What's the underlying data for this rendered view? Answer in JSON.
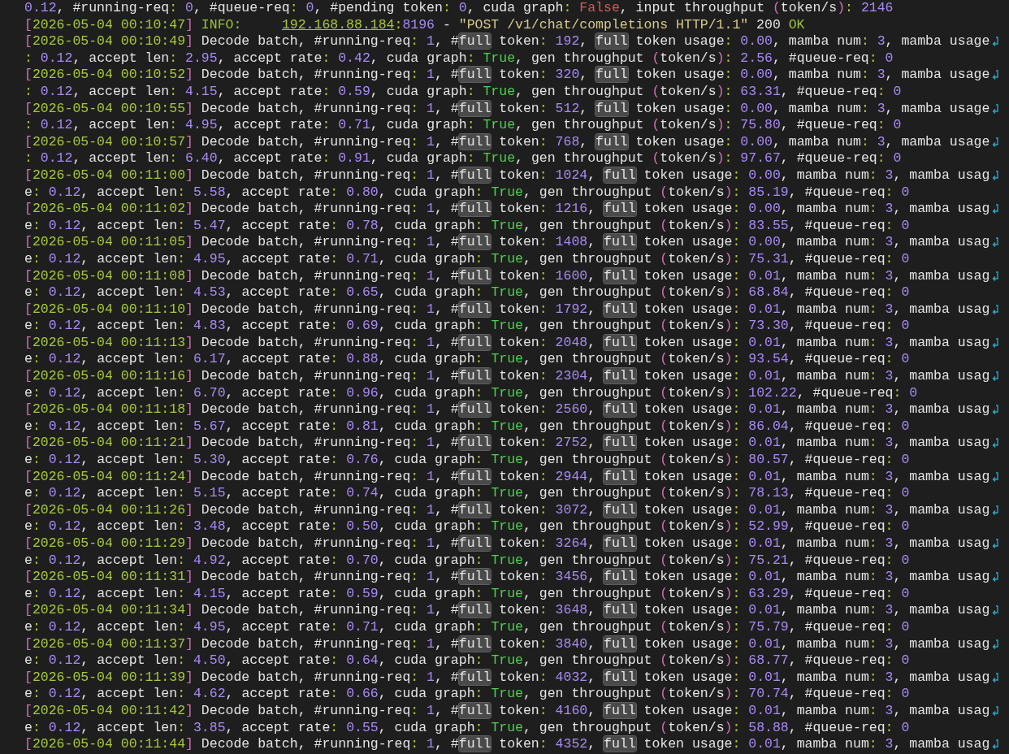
{
  "terminal": {
    "top_line": "0.12, #running-req: 0, #queue-req: 0, #pending token: 0, cuda graph: False, input throughput (token/s): 2146",
    "request_line": [
      {
        "text": "[2026-05-04 00:10:47]",
        "kind": "timestamp"
      },
      {
        "text": " INFO:     ",
        "kind": "level"
      },
      {
        "text": "192.168.88.184",
        "kind": "address"
      },
      {
        "text": ":8196",
        "kind": "port"
      },
      {
        "text": " - ",
        "kind": "plain"
      },
      {
        "text": "\"POST /v1/chat/completions HTTP/1.1\"",
        "kind": "string"
      },
      {
        "text": " 200 ",
        "kind": "plain"
      },
      {
        "text": "OK",
        "kind": "status"
      }
    ],
    "entries": [
      {
        "parts": [
          "[2026-05-04 00:10:49] Decode batch, #running-req: 1, #",
          "full",
          " token: 192, ",
          "full",
          " token usage: 0.00, mamba num: 3, mamba usage: 0.12, accept len: 2.95, accept rate: 0.42, cuda graph: True, gen throughput (token/s): 2.56, #queue-req: 0"
        ]
      },
      {
        "parts": [
          "[2026-05-04 00:10:52] Decode batch, #running-req: 1, #",
          "full",
          " token: 320, ",
          "full",
          " token usage: 0.00, mamba num: 3, mamba usage: 0.12, accept len: 4.15, accept rate: 0.59, cuda graph: True, gen throughput (token/s): 63.31, #queue-req: 0"
        ]
      },
      {
        "parts": [
          "[2026-05-04 00:10:55] Decode batch, #running-req: 1, #",
          "full",
          " token: 512, ",
          "full",
          " token usage: 0.00, mamba num: 3, mamba usage: 0.12, accept len: 4.95, accept rate: 0.71, cuda graph: True, gen throughput (token/s): 75.80, #queue-req: 0"
        ]
      },
      {
        "parts": [
          "[2026-05-04 00:10:57] Decode batch, #running-req: 1, #",
          "full",
          " token: 768, ",
          "full",
          " token usage: 0.00, mamba num: 3, mamba usage: 0.12, accept len: 6.40, accept rate: 0.91, cuda graph: True, gen throughput (token/s): 97.67, #queue-req: 0"
        ]
      },
      {
        "parts": [
          "[2026-05-04 00:11:00] Decode batch, #running-req: 1, #",
          "full",
          " token: 1024, ",
          "full",
          " token usage: 0.00, mamba num: 3, mamba usage: 0.12, accept len: 5.58, accept rate: 0.80, cuda graph: True, gen throughput (token/s): 85.19, #queue-req: 0"
        ]
      },
      {
        "parts": [
          "[2026-05-04 00:11:02] Decode batch, #running-req: 1, #",
          "full",
          " token: 1216, ",
          "full",
          " token usage: 0.00, mamba num: 3, mamba usage: 0.12, accept len: 5.47, accept rate: 0.78, cuda graph: True, gen throughput (token/s): 83.55, #queue-req: 0"
        ]
      },
      {
        "parts": [
          "[2026-05-04 00:11:05] Decode batch, #running-req: 1, #",
          "full",
          " token: 1408, ",
          "full",
          " token usage: 0.00, mamba num: 3, mamba usage: 0.12, accept len: 4.95, accept rate: 0.71, cuda graph: True, gen throughput (token/s): 75.31, #queue-req: 0"
        ]
      },
      {
        "parts": [
          "[2026-05-04 00:11:08] Decode batch, #running-req: 1, #",
          "full",
          " token: 1600, ",
          "full",
          " token usage: 0.01, mamba num: 3, mamba usage: 0.12, accept len: 4.53, accept rate: 0.65, cuda graph: True, gen throughput (token/s): 68.84, #queue-req: 0"
        ]
      },
      {
        "parts": [
          "[2026-05-04 00:11:10] Decode batch, #running-req: 1, #",
          "full",
          " token: 1792, ",
          "full",
          " token usage: 0.01, mamba num: 3, mamba usage: 0.12, accept len: 4.83, accept rate: 0.69, cuda graph: True, gen throughput (token/s): 73.30, #queue-req: 0"
        ]
      },
      {
        "parts": [
          "[2026-05-04 00:11:13] Decode batch, #running-req: 1, #",
          "full",
          " token: 2048, ",
          "full",
          " token usage: 0.01, mamba num: 3, mamba usage: 0.12, accept len: 6.17, accept rate: 0.88, cuda graph: True, gen throughput (token/s): 93.54, #queue-req: 0"
        ]
      },
      {
        "parts": [
          "[2026-05-04 00:11:16] Decode batch, #running-req: 1, #",
          "full",
          " token: 2304, ",
          "full",
          " token usage: 0.01, mamba num: 3, mamba usage: 0.12, accept len: 6.70, accept rate: 0.96, cuda graph: True, gen throughput (token/s): 102.22, #queue-req: 0"
        ]
      },
      {
        "parts": [
          "[2026-05-04 00:11:18] Decode batch, #running-req: 1, #",
          "full",
          " token: 2560, ",
          "full",
          " token usage: 0.01, mamba num: 3, mamba usage: 0.12, accept len: 5.67, accept rate: 0.81, cuda graph: True, gen throughput (token/s): 86.04, #queue-req: 0"
        ]
      },
      {
        "parts": [
          "[2026-05-04 00:11:21] Decode batch, #running-req: 1, #",
          "full",
          " token: 2752, ",
          "full",
          " token usage: 0.01, mamba num: 3, mamba usage: 0.12, accept len: 5.30, accept rate: 0.76, cuda graph: True, gen throughput (token/s): 80.57, #queue-req: 0"
        ]
      },
      {
        "parts": [
          "[2026-05-04 00:11:24] Decode batch, #running-req: 1, #",
          "full",
          " token: 2944, ",
          "full",
          " token usage: 0.01, mamba num: 3, mamba usage: 0.12, accept len: 5.15, accept rate: 0.74, cuda graph: True, gen throughput (token/s): 78.13, #queue-req: 0"
        ]
      },
      {
        "parts": [
          "[2026-05-04 00:11:26] Decode batch, #running-req: 1, #",
          "full",
          " token: 3072, ",
          "full",
          " token usage: 0.01, mamba num: 3, mamba usage: 0.12, accept len: 3.48, accept rate: 0.50, cuda graph: True, gen throughput (token/s): 52.99, #queue-req: 0"
        ]
      },
      {
        "parts": [
          "[2026-05-04 00:11:29] Decode batch, #running-req: 1, #",
          "full",
          " token: 3264, ",
          "full",
          " token usage: 0.01, mamba num: 3, mamba usage: 0.12, accept len: 4.92, accept rate: 0.70, cuda graph: True, gen throughput (token/s): 75.21, #queue-req: 0"
        ]
      },
      {
        "parts": [
          "[2026-05-04 00:11:31] Decode batch, #running-req: 1, #",
          "full",
          " token: 3456, ",
          "full",
          " token usage: 0.01, mamba num: 3, mamba usage: 0.12, accept len: 4.15, accept rate: 0.59, cuda graph: True, gen throughput (token/s): 63.29, #queue-req: 0"
        ]
      },
      {
        "parts": [
          "[2026-05-04 00:11:34] Decode batch, #running-req: 1, #",
          "full",
          " token: 3648, ",
          "full",
          " token usage: 0.01, mamba num: 3, mamba usage: 0.12, accept len: 4.95, accept rate: 0.71, cuda graph: True, gen throughput (token/s): 75.79, #queue-req: 0"
        ]
      },
      {
        "parts": [
          "[2026-05-04 00:11:37] Decode batch, #running-req: 1, #",
          "full",
          " token: 3840, ",
          "full",
          " token usage: 0.01, mamba num: 3, mamba usage: 0.12, accept len: 4.50, accept rate: 0.64, cuda graph: True, gen throughput (token/s): 68.77, #queue-req: 0"
        ]
      },
      {
        "parts": [
          "[2026-05-04 00:11:39] Decode batch, #running-req: 1, #",
          "full",
          " token: 4032, ",
          "full",
          " token usage: 0.01, mamba num: 3, mamba usage: 0.12, accept len: 4.62, accept rate: 0.66, cuda graph: True, gen throughput (token/s): 70.74, #queue-req: 0"
        ]
      },
      {
        "parts": [
          "[2026-05-04 00:11:42] Decode batch, #running-req: 1, #",
          "full",
          " token: 4160, ",
          "full",
          " token usage: 0.01, mamba num: 3, mamba usage: 0.12, accept len: 3.85, accept rate: 0.55, cuda graph: True, gen throughput (token/s): 58.88, #queue-req: 0"
        ]
      },
      {
        "parts": [
          "[2026-05-04 00:11:44] Decode batch, #running-req: 1, #",
          "full",
          " token: 4352, ",
          "full",
          " token usage: 0.01, mamba num: 3, mamba usag"
        ]
      }
    ]
  }
}
